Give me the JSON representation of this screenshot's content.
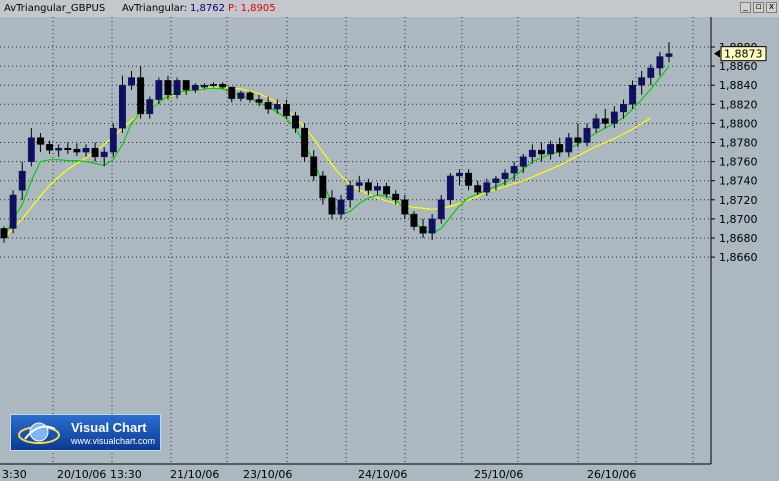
{
  "header": {
    "instrument_label": "AvTriangular_GBPUS",
    "indicator_label": "AvTriangular:",
    "indicator_value": "1,8762",
    "price_label": "P: 1,8905",
    "minimize_icon": "_",
    "restore_icon": "▫",
    "close_icon": "x"
  },
  "logo": {
    "title": "Visual Chart",
    "url": "www.visualchart.com"
  },
  "colors": {
    "background": "#acb8c0",
    "grid": "#2b2b2b",
    "bull_candle": "#101060",
    "bear_candle": "#000000",
    "wick": "#000000",
    "fast_ma": "#00d000",
    "slow_ma": "#ffff00",
    "price_box": "#ffffc0",
    "header_blue": "#000080",
    "header_red": "#e00000"
  },
  "chart_data": {
    "type": "candlestick",
    "y_ticks": [
      "1,8880",
      "1,8860",
      "1,8840",
      "1,8820",
      "1,8800",
      "1,8780",
      "1,8760",
      "1,8740",
      "1,8720",
      "1,8700",
      "1,8680",
      "1,8660"
    ],
    "ylim": [
      1.8655,
      1.8895
    ],
    "x_ticks": [
      "3:30",
      "20/10/06",
      "13:30",
      "21/10/06",
      "23/10/06",
      "24/10/06",
      "25/10/06",
      "26/10/06"
    ],
    "last_price_label": "1,8873",
    "last_price": 1.8873,
    "series": [
      {
        "name": "Price",
        "candles": [
          [
            1.869,
            1.8692,
            1.8675,
            1.868
          ],
          [
            1.869,
            1.873,
            1.8685,
            1.8725
          ],
          [
            1.873,
            1.876,
            1.872,
            1.875
          ],
          [
            1.876,
            1.8795,
            1.8755,
            1.8785
          ],
          [
            1.8785,
            1.879,
            1.877,
            1.8778
          ],
          [
            1.8778,
            1.8782,
            1.8768,
            1.8772
          ],
          [
            1.8772,
            1.8778,
            1.8765,
            1.8774
          ],
          [
            1.8774,
            1.878,
            1.8768,
            1.8773
          ],
          [
            1.8773,
            1.8779,
            1.8766,
            1.877
          ],
          [
            1.877,
            1.8778,
            1.8765,
            1.8774
          ],
          [
            1.8774,
            1.878,
            1.876,
            1.8765
          ],
          [
            1.8765,
            1.8775,
            1.8755,
            1.877
          ],
          [
            1.877,
            1.88,
            1.8765,
            1.8795
          ],
          [
            1.8795,
            1.885,
            1.879,
            1.884
          ],
          [
            1.884,
            1.8855,
            1.8835,
            1.8848
          ],
          [
            1.8848,
            1.886,
            1.8805,
            1.881
          ],
          [
            1.881,
            1.8828,
            1.8805,
            1.8825
          ],
          [
            1.8825,
            1.8848,
            1.882,
            1.8845
          ],
          [
            1.8845,
            1.885,
            1.8825,
            1.883
          ],
          [
            1.883,
            1.8848,
            1.8826,
            1.8845
          ],
          [
            1.8845,
            1.8845,
            1.883,
            1.8835
          ],
          [
            1.8835,
            1.8842,
            1.8832,
            1.884
          ],
          [
            1.8838,
            1.8842,
            1.8836,
            1.884
          ],
          [
            1.884,
            1.8843,
            1.8838,
            1.8841
          ],
          [
            1.8841,
            1.8843,
            1.8836,
            1.8838
          ],
          [
            1.8838,
            1.8838,
            1.8822,
            1.8826
          ],
          [
            1.8826,
            1.8834,
            1.8823,
            1.8832
          ],
          [
            1.8832,
            1.8834,
            1.8822,
            1.8825
          ],
          [
            1.8825,
            1.883,
            1.8818,
            1.8822
          ],
          [
            1.8822,
            1.8828,
            1.881,
            1.8815
          ],
          [
            1.8815,
            1.8825,
            1.881,
            1.882
          ],
          [
            1.882,
            1.8825,
            1.8805,
            1.8808
          ],
          [
            1.8808,
            1.8812,
            1.879,
            1.8795
          ],
          [
            1.8795,
            1.88,
            1.876,
            1.8765
          ],
          [
            1.8765,
            1.8772,
            1.874,
            1.8745
          ],
          [
            1.8745,
            1.875,
            1.8715,
            1.8722
          ],
          [
            1.8722,
            1.873,
            1.87,
            1.8705
          ],
          [
            1.8705,
            1.8725,
            1.87,
            1.872
          ],
          [
            1.872,
            1.874,
            1.8712,
            1.8735
          ],
          [
            1.8735,
            1.8745,
            1.8728,
            1.8738
          ],
          [
            1.8738,
            1.8742,
            1.8725,
            1.873
          ],
          [
            1.873,
            1.8738,
            1.8725,
            1.8734
          ],
          [
            1.8734,
            1.8738,
            1.8722,
            1.8726
          ],
          [
            1.8726,
            1.873,
            1.8715,
            1.872
          ],
          [
            1.872,
            1.8725,
            1.87,
            1.8705
          ],
          [
            1.8705,
            1.8708,
            1.8688,
            1.8692
          ],
          [
            1.8692,
            1.87,
            1.868,
            1.8685
          ],
          [
            1.8685,
            1.8705,
            1.8678,
            1.87
          ],
          [
            1.87,
            1.8725,
            1.8695,
            1.872
          ],
          [
            1.872,
            1.8748,
            1.8715,
            1.8745
          ],
          [
            1.8745,
            1.8752,
            1.8735,
            1.8748
          ],
          [
            1.8748,
            1.8752,
            1.873,
            1.8735
          ],
          [
            1.8735,
            1.874,
            1.8725,
            1.8728
          ],
          [
            1.8728,
            1.8742,
            1.8724,
            1.8738
          ],
          [
            1.8738,
            1.8745,
            1.873,
            1.8742
          ],
          [
            1.8742,
            1.8752,
            1.8735,
            1.8748
          ],
          [
            1.8748,
            1.876,
            1.874,
            1.8755
          ],
          [
            1.8755,
            1.8768,
            1.8748,
            1.8765
          ],
          [
            1.8765,
            1.8778,
            1.8758,
            1.8772
          ],
          [
            1.8772,
            1.878,
            1.876,
            1.8768
          ],
          [
            1.8768,
            1.8782,
            1.8762,
            1.8778
          ],
          [
            1.8778,
            1.8785,
            1.8765,
            1.877
          ],
          [
            1.877,
            1.879,
            1.8765,
            1.8785
          ],
          [
            1.8785,
            1.88,
            1.8775,
            1.878
          ],
          [
            1.878,
            1.88,
            1.8776,
            1.8795
          ],
          [
            1.8795,
            1.881,
            1.879,
            1.8805
          ],
          [
            1.8805,
            1.8815,
            1.8795,
            1.88
          ],
          [
            1.88,
            1.8818,
            1.8795,
            1.8812
          ],
          [
            1.8812,
            1.8825,
            1.8805,
            1.882
          ],
          [
            1.882,
            1.8845,
            1.8815,
            1.884
          ],
          [
            1.884,
            1.8855,
            1.883,
            1.8848
          ],
          [
            1.8848,
            1.8862,
            1.884,
            1.8858
          ],
          [
            1.8858,
            1.8875,
            1.885,
            1.887
          ],
          [
            1.887,
            1.8885,
            1.8864,
            1.8873
          ]
        ]
      },
      {
        "name": "AvTriangular fast",
        "values": [
          1.868,
          1.87,
          1.8715,
          1.874,
          1.876,
          1.8762,
          1.8762,
          1.8761,
          1.8761,
          1.876,
          1.8758,
          1.8756,
          1.8762,
          1.8778,
          1.88,
          1.8812,
          1.8815,
          1.8822,
          1.8828,
          1.8832,
          1.8834,
          1.8835,
          1.8836,
          1.8837,
          1.8836,
          1.8832,
          1.8829,
          1.8826,
          1.8822,
          1.8817,
          1.8812,
          1.8805,
          1.8795,
          1.8778,
          1.876,
          1.8738,
          1.8717,
          1.8705,
          1.8708,
          1.8716,
          1.8722,
          1.8725,
          1.8724,
          1.872,
          1.871,
          1.8698,
          1.8688,
          1.8685,
          1.869,
          1.8702,
          1.8714,
          1.8722,
          1.8726,
          1.873,
          1.8734,
          1.8738,
          1.8744,
          1.8752,
          1.876,
          1.8764,
          1.8768,
          1.877,
          1.8774,
          1.8778,
          1.8784,
          1.879,
          1.8795,
          1.88,
          1.8806,
          1.8815,
          1.8825,
          1.8836,
          1.8848,
          1.886
        ]
      },
      {
        "name": "AvTriangular slow",
        "values": [
          1.868,
          1.869,
          1.87,
          1.8712,
          1.8724,
          1.8735,
          1.8744,
          1.8752,
          1.8758,
          1.8764,
          1.877,
          1.8778,
          1.8786,
          1.8795,
          1.8803,
          1.881,
          1.8817,
          1.8822,
          1.8827,
          1.8831,
          1.8834,
          1.8836,
          1.8837,
          1.8838,
          1.8838,
          1.8837,
          1.8836,
          1.8834,
          1.8831,
          1.8827,
          1.8822,
          1.8815,
          1.8806,
          1.8796,
          1.8784,
          1.877,
          1.8757,
          1.8745,
          1.8736,
          1.873,
          1.8726,
          1.8722,
          1.8719,
          1.8716,
          1.8714,
          1.8712,
          1.8711,
          1.871,
          1.8711,
          1.8713,
          1.8716,
          1.872,
          1.8724,
          1.8728,
          1.8731,
          1.8734,
          1.8737,
          1.874,
          1.8744,
          1.8748,
          1.8752,
          1.8756,
          1.8761,
          1.8766,
          1.8771,
          1.8776,
          1.878,
          1.8784,
          1.8789,
          1.8794,
          1.88,
          1.8806
        ]
      }
    ]
  }
}
